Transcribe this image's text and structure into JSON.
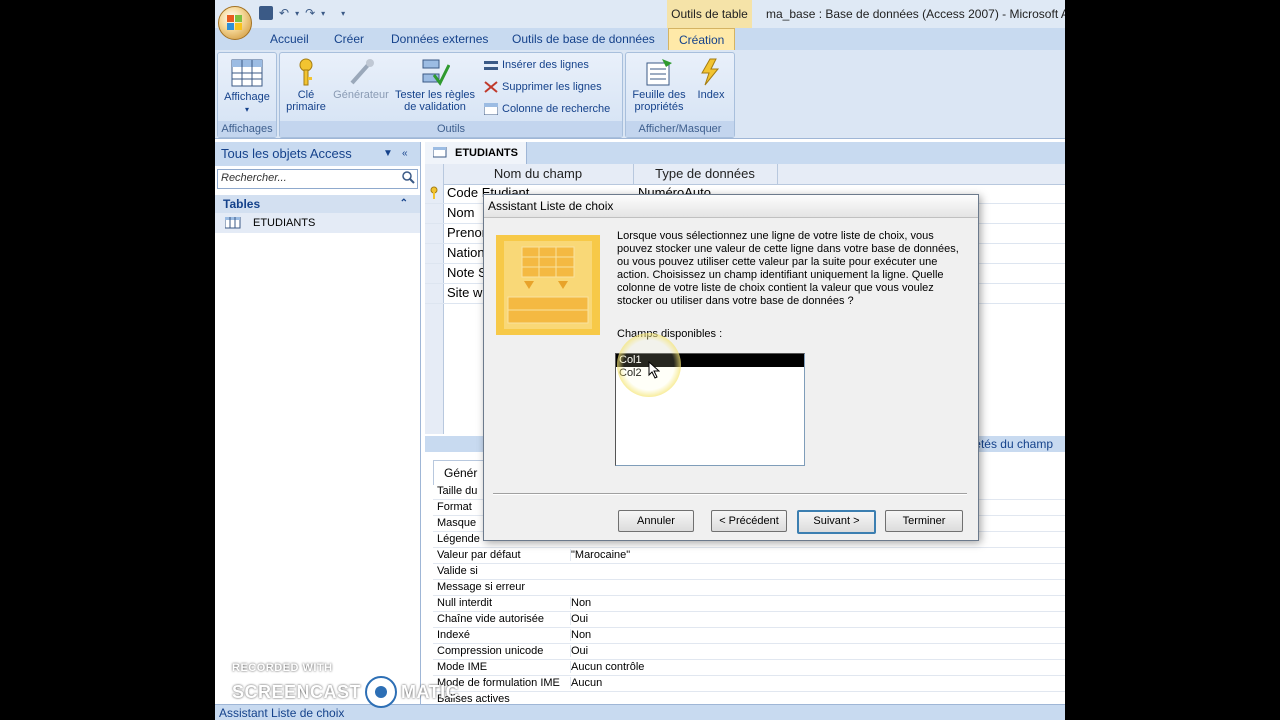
{
  "window": {
    "context_header": "Outils de table",
    "app_title": "ma_base : Base de données (Access 2007) - Microsoft Ac"
  },
  "tabs": [
    "Accueil",
    "Créer",
    "Données externes",
    "Outils de base de données",
    "Création"
  ],
  "ribbon": {
    "affichage": "Affichage",
    "affichages_group": "Affichages",
    "cle_primaire_1": "Clé",
    "cle_primaire_2": "primaire",
    "generateur": "Générateur",
    "tester_1": "Tester les règles",
    "tester_2": "de validation",
    "inserer": "Insérer des lignes",
    "supprimer": "Supprimer les lignes",
    "colonne": "Colonne de recherche",
    "outils_group": "Outils",
    "feuille_1": "Feuille des",
    "feuille_2": "propriétés",
    "index": "Index",
    "afficher_group": "Afficher/Masquer"
  },
  "nav": {
    "header": "Tous les objets Access",
    "search_placeholder": "Rechercher...",
    "group": "Tables",
    "items": [
      "ETUDIANTS"
    ]
  },
  "document": {
    "tab": "ETUDIANTS",
    "col_name": "Nom du champ",
    "col_type": "Type de données",
    "rows": [
      {
        "name": "Code Etudiant",
        "type": "NuméroAuto"
      },
      {
        "name": "Nom",
        "type": ""
      },
      {
        "name": "Prenom",
        "type": ""
      },
      {
        "name": "Nationalite",
        "type": ""
      },
      {
        "name": "Note S",
        "type": ""
      },
      {
        "name": "Site w",
        "type": ""
      }
    ],
    "props_bar": "étés du champ",
    "props_tab": "Génér",
    "props": [
      {
        "k": "Taille du",
        "v": ""
      },
      {
        "k": "Format",
        "v": ""
      },
      {
        "k": "Masque",
        "v": ""
      },
      {
        "k": "Légende",
        "v": ""
      },
      {
        "k": "Valeur par défaut",
        "v": "\"Marocaine\""
      },
      {
        "k": "Valide si",
        "v": ""
      },
      {
        "k": "Message si erreur",
        "v": ""
      },
      {
        "k": "Null interdit",
        "v": "Non"
      },
      {
        "k": "Chaîne vide autorisée",
        "v": "Oui"
      },
      {
        "k": "Indexé",
        "v": "Non"
      },
      {
        "k": "Compression unicode",
        "v": "Oui"
      },
      {
        "k": "Mode IME",
        "v": "Aucun contrôle"
      },
      {
        "k": "Mode de formulation IME",
        "v": "Aucun"
      },
      {
        "k": "Balises actives",
        "v": ""
      }
    ]
  },
  "dialog": {
    "title": "Assistant Liste de choix",
    "text": "Lorsque vous sélectionnez une ligne de votre liste de choix, vous pouvez stocker une valeur de cette ligne dans votre base de données, ou vous pouvez utiliser cette valeur par la suite pour exécuter une action. Choisissez un champ identifiant uniquement la ligne. Quelle colonne de votre liste de choix contient la valeur que vous voulez stocker ou utiliser dans votre base de données ?",
    "label": "Champs disponibles :",
    "fields": [
      "Col1",
      "Col2"
    ],
    "selected_index": 0,
    "btn_cancel": "Annuler",
    "btn_prev": "< Précédent",
    "btn_next": "Suivant >",
    "btn_finish": "Terminer"
  },
  "status": "Assistant Liste de choix",
  "watermark": {
    "line1": "RECORDED WITH",
    "line2a": "SCREENCAST",
    "line2b": "MATIC"
  }
}
